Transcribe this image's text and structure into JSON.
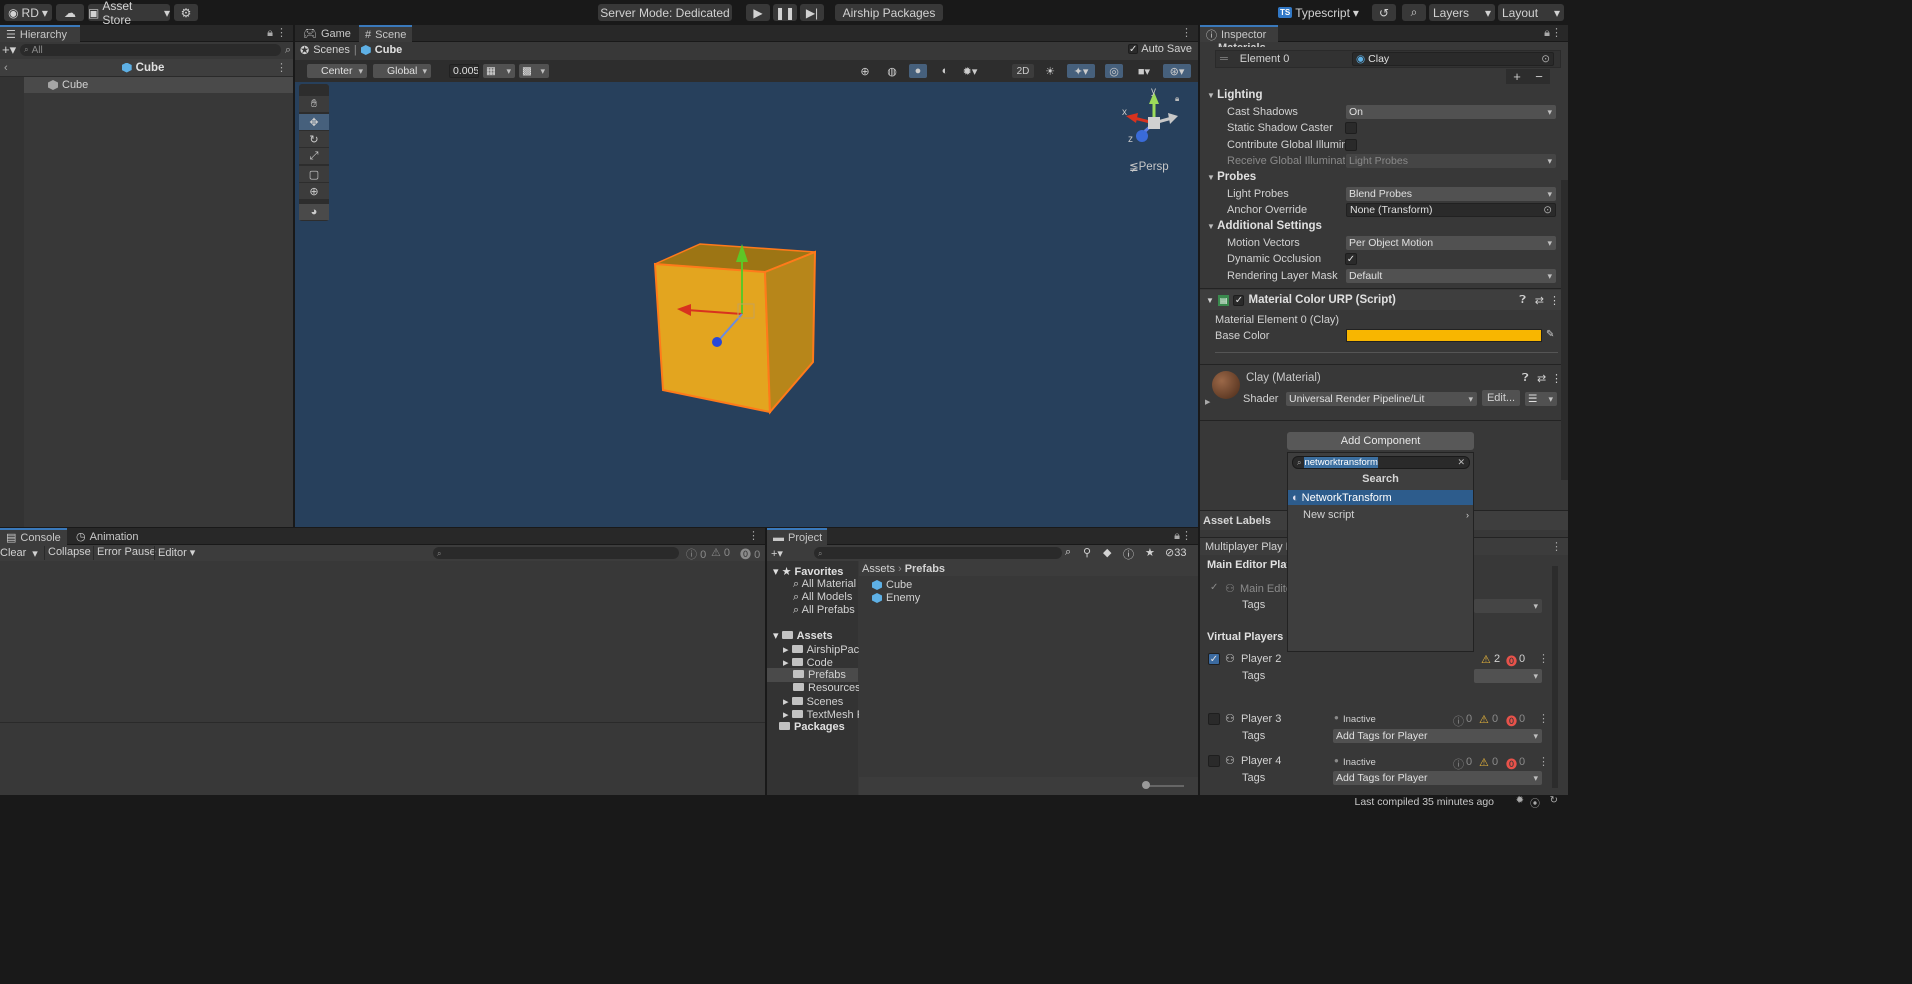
{
  "toolbar": {
    "account": "RD",
    "asset_store": "Asset Store",
    "server_mode": "Server Mode: Dedicated",
    "airship_packages": "Airship Packages",
    "typescript": "Typescript",
    "layers": "Layers",
    "layout": "Layout"
  },
  "hierarchy": {
    "tab": "Hierarchy",
    "search_placeholder": "All",
    "scene_title": "Cube",
    "items": [
      "Cube"
    ]
  },
  "scene": {
    "tabs": [
      "Game",
      "Scene"
    ],
    "breadcrumb": [
      "Scenes",
      "Cube"
    ],
    "auto_save": "Auto Save",
    "pivot": "Center",
    "space": "Global",
    "snap_value": "0.005",
    "mode_2d": "2D",
    "persp": "≨Persp",
    "gizmo_axes": [
      "y",
      "x",
      "z"
    ],
    "cube_color": "#e3a51f"
  },
  "inspector": {
    "tab": "Inspector",
    "materials_label": "Materials",
    "element0_label": "Element 0",
    "element0_value": "Clay",
    "lighting": {
      "title": "Lighting",
      "cast_shadows_label": "Cast Shadows",
      "cast_shadows_value": "On",
      "static_shadow_label": "Static Shadow Caster",
      "contribute_gi_label": "Contribute Global Illumina",
      "receive_gi_label": "Receive Global Illuminatic",
      "receive_gi_value": "Light Probes"
    },
    "probes": {
      "title": "Probes",
      "light_probes_label": "Light Probes",
      "light_probes_value": "Blend Probes",
      "anchor_label": "Anchor Override",
      "anchor_value": "None (Transform)"
    },
    "additional": {
      "title": "Additional Settings",
      "motion_vectors_label": "Motion Vectors",
      "motion_vectors_value": "Per Object Motion",
      "dynamic_occlusion_label": "Dynamic Occlusion",
      "rendering_layer_label": "Rendering Layer Mask",
      "rendering_layer_value": "Default"
    },
    "material_color": {
      "title": "Material Color URP (Script)",
      "element_label": "Material Element 0 (Clay)",
      "base_color_label": "Base Color",
      "base_color": "#f8b600"
    },
    "material": {
      "title": "Clay (Material)",
      "shader_label": "Shader",
      "shader_value": "Universal Render Pipeline/Lit",
      "edit_label": "Edit..."
    },
    "add_component": "Add Component",
    "asset_labels": "Asset Labels"
  },
  "add_component_popup": {
    "search_value": "networktransform",
    "header": "Search",
    "results": [
      "NetworkTransform",
      "New script"
    ]
  },
  "multiplayer": {
    "title": "Multiplayer Play M",
    "main_editor": "Main Editor Playe",
    "main_editor_row": "Main Edito",
    "tags_label": "Tags",
    "virtual_players": "Virtual Players",
    "players": [
      {
        "name": "Player 2",
        "status": "",
        "info": "",
        "warn": "2",
        "err": "0",
        "tags": ""
      },
      {
        "name": "Player 3",
        "status": "Inactive",
        "info": "0",
        "warn": "0",
        "err": "0",
        "tags": "Add Tags for Player"
      },
      {
        "name": "Player 4",
        "status": "Inactive",
        "info": "0",
        "warn": "0",
        "err": "0",
        "tags": "Add Tags for Player"
      }
    ]
  },
  "console": {
    "tabs": [
      "Console",
      "Animation"
    ],
    "clear": "Clear",
    "collapse": "Collapse",
    "error_pause": "Error Pause",
    "editor": "Editor",
    "counts": [
      "0",
      "0",
      "0"
    ]
  },
  "project": {
    "tab": "Project",
    "hidden_count": "33",
    "favorites_title": "Favorites",
    "favorites": [
      "All Material",
      "All Models",
      "All Prefabs"
    ],
    "assets_title": "Assets",
    "asset_folders": [
      "AirshipPack",
      "Code",
      "Prefabs",
      "Resources",
      "Scenes",
      "TextMesh P"
    ],
    "packages_title": "Packages",
    "breadcrumb": [
      "Assets",
      "Prefabs"
    ],
    "items": [
      "Cube",
      "Enemy"
    ]
  },
  "status": {
    "last_compiled": "Last compiled 35 minutes ago"
  }
}
